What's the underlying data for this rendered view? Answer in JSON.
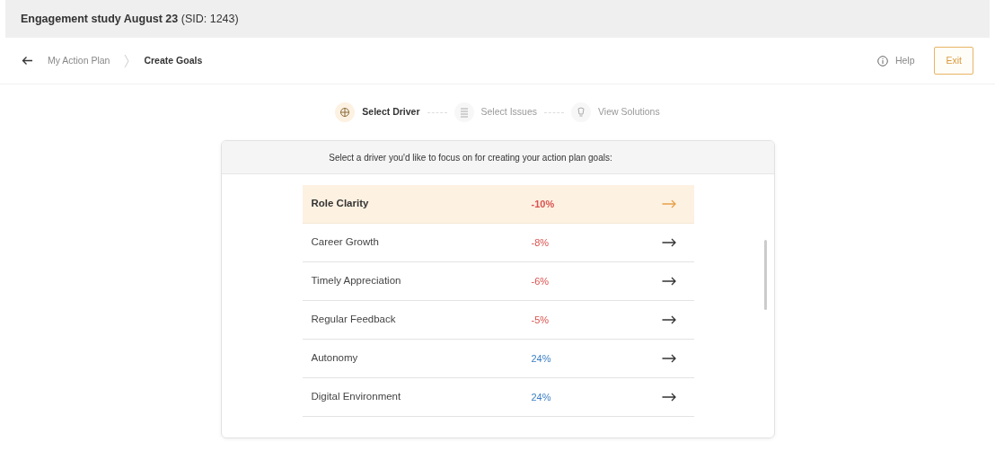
{
  "header": {
    "title": "**Engagement study August 23** (SID: 1243)"
  },
  "breadcrumb": [
    {
      "label": "My Action Plan",
      "selected": false
    },
    {
      "label": "Create Goals",
      "selected": true
    }
  ],
  "help": {
    "label": "Help"
  },
  "exit_button": {
    "label": "Exit"
  },
  "steps": [
    {
      "label": "Select Driver",
      "selected": true,
      "kind": "driver"
    },
    {
      "label": "Select Issues",
      "selected": false,
      "kind": "issues"
    },
    {
      "label": "View Solutions",
      "selected": false,
      "kind": "solutions"
    }
  ],
  "prompt": "Select a driver you'd like to focus on for creating your action plan goals:",
  "drivers": [
    {
      "name": "Role Clarity",
      "value": "-10%",
      "kind": "negative",
      "selected": true
    },
    {
      "name": "Career Growth",
      "value": "-8%",
      "kind": "negative",
      "selected": false
    },
    {
      "name": "Timely Appreciation",
      "value": "-6%",
      "kind": "negative",
      "selected": false
    },
    {
      "name": "Regular Feedback",
      "value": "-5%",
      "kind": "negative",
      "selected": false
    },
    {
      "name": "Autonomy",
      "value": "24%",
      "kind": "positive",
      "selected": false
    },
    {
      "name": "Digital Environment",
      "value": "24%",
      "kind": "positive",
      "selected": false
    }
  ]
}
